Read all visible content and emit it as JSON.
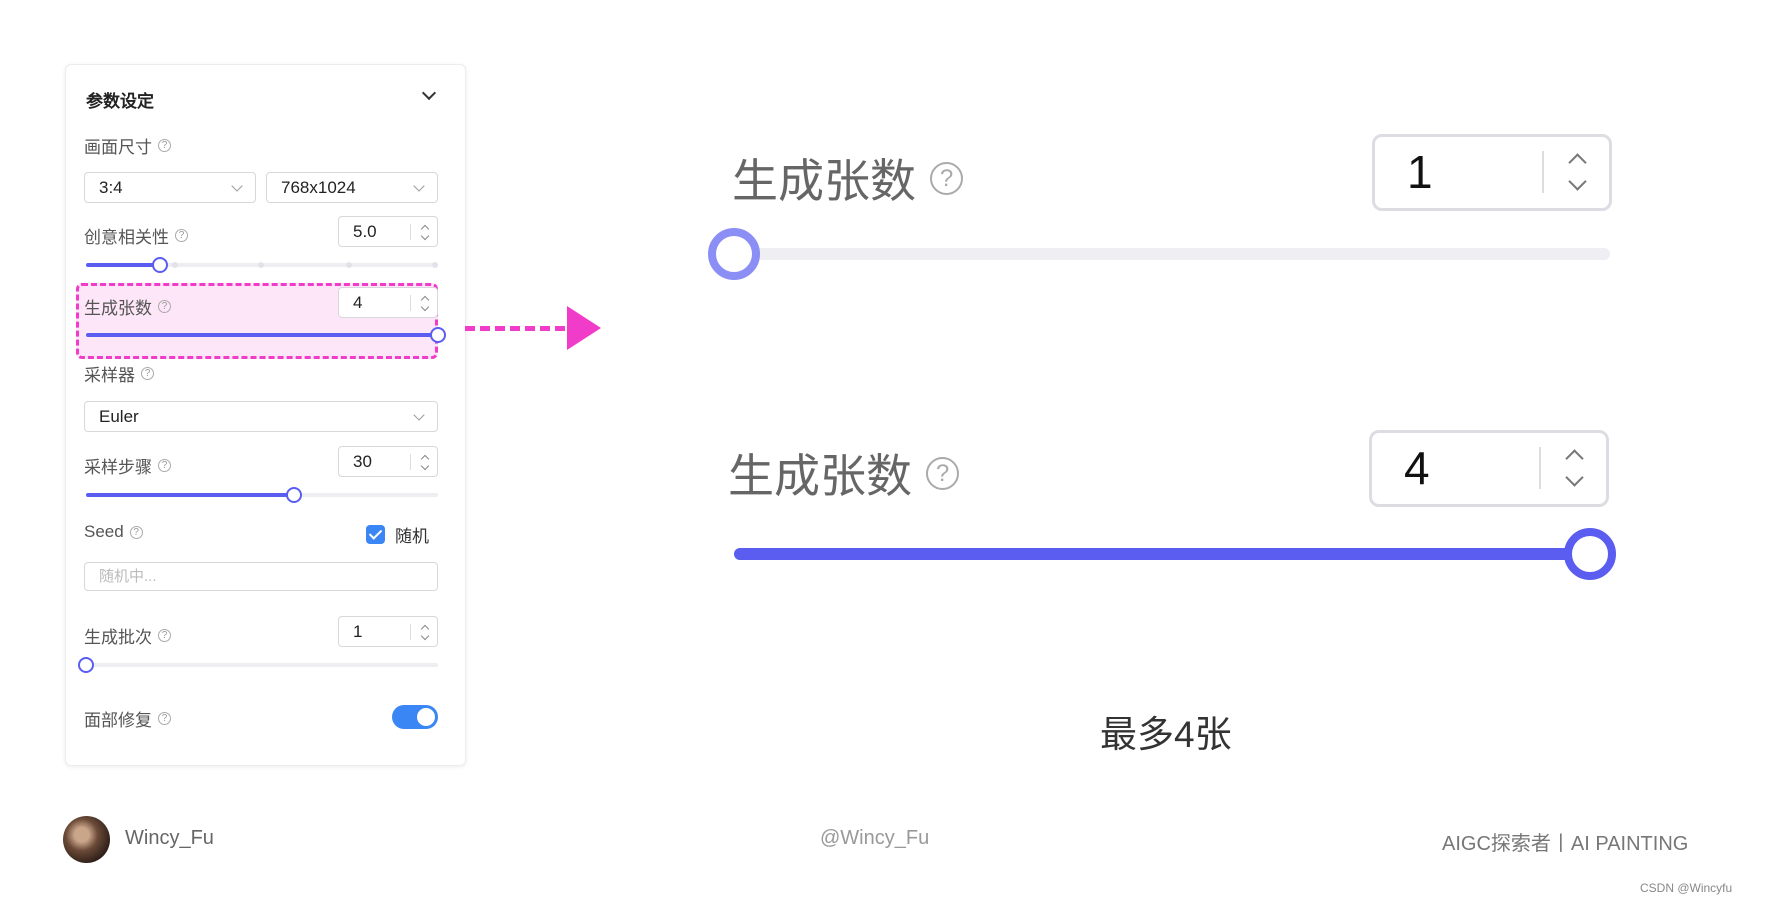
{
  "panel": {
    "title": "参数设定",
    "canvas_size": {
      "label": "画面尺寸",
      "ratio": "3:4",
      "resolution": "768x1024"
    },
    "creativity": {
      "label": "创意相关性",
      "value": "5.0",
      "level": 0.21
    },
    "count": {
      "label": "生成张数",
      "value": "4",
      "level": 1.0
    },
    "sampler": {
      "label": "采样器",
      "value": "Euler"
    },
    "steps": {
      "label": "采样步骤",
      "value": "30",
      "level": 0.59
    },
    "seed": {
      "label": "Seed",
      "random_label": "随机",
      "random_checked": true,
      "placeholder": "随机中..."
    },
    "batch": {
      "label": "生成批次",
      "value": "1",
      "level": 0.0
    },
    "face_fix": {
      "label": "面部修复",
      "enabled": true
    }
  },
  "zoom": {
    "top": {
      "label": "生成张数",
      "value": "1",
      "level": 0.0
    },
    "bottom": {
      "label": "生成张数",
      "value": "4",
      "level": 1.0
    },
    "caption": "最多4张"
  },
  "footer": {
    "author": "Wincy_Fu",
    "handle": "@Wincy_Fu",
    "tagline": "AIGC探索者丨AI PAINTING",
    "watermark": "CSDN @Wincyfu"
  },
  "colors": {
    "accent": "#5a5df0",
    "highlight": "#f03cc8",
    "toggle": "#3a86f5",
    "thumb_light": "#8a8ef5"
  }
}
